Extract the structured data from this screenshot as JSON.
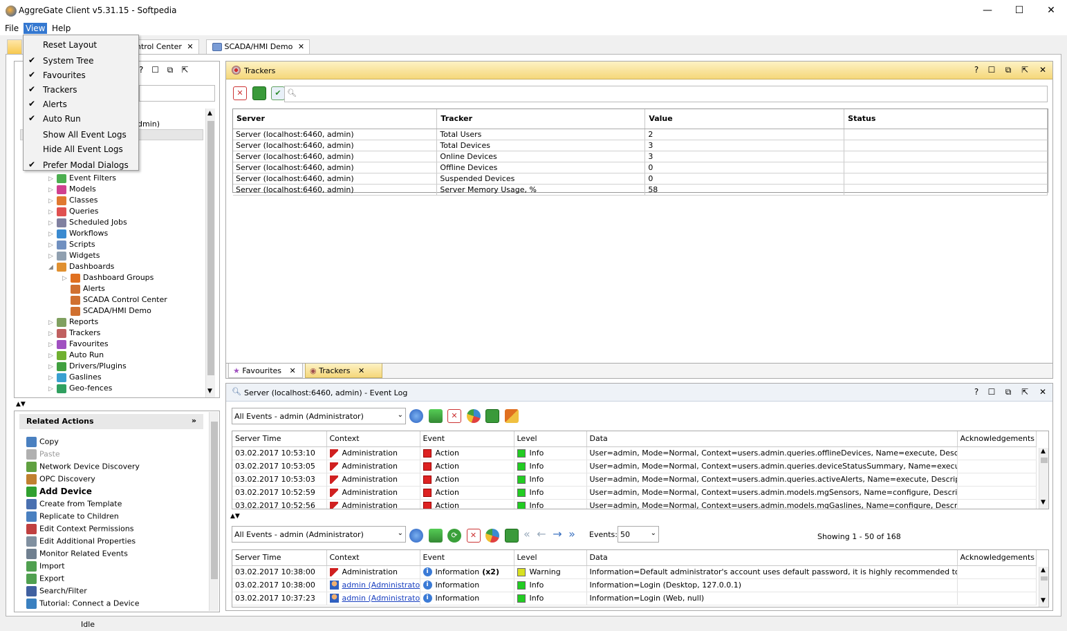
{
  "window": {
    "title": "AggreGate Client v5.31.15 - Softpedia",
    "minimize": "—",
    "maximize": "☐",
    "close": "✕"
  },
  "menubar": {
    "file": "File",
    "view": "View",
    "help": "Help"
  },
  "view_menu": {
    "items": [
      {
        "label": "Reset Layout",
        "checked": false
      },
      {
        "label": "System Tree",
        "checked": true
      },
      {
        "label": "Favourites",
        "checked": true
      },
      {
        "label": "Trackers",
        "checked": true
      },
      {
        "label": "Alerts",
        "checked": true
      },
      {
        "label": "Auto Run",
        "checked": true
      },
      {
        "label": "Show All Event Logs",
        "checked": false
      },
      {
        "label": "Hide All Event Logs",
        "checked": false
      },
      {
        "label": "Prefer Modal Dialogs",
        "checked": true
      }
    ],
    "check": "✔"
  },
  "doc_tabs": {
    "tab1": "ntrol Center",
    "tab2": "SCADA/HMI Demo",
    "close": "✕"
  },
  "system_tree": {
    "partial": "dmin)",
    "items": [
      {
        "label": "Event Filters",
        "arrow": "▷",
        "color": "#4caf50",
        "indent": 0
      },
      {
        "label": "Models",
        "arrow": "▷",
        "color": "#d04090",
        "indent": 0
      },
      {
        "label": "Classes",
        "arrow": "▷",
        "color": "#e07830",
        "indent": 0
      },
      {
        "label": "Queries",
        "arrow": "▷",
        "color": "#e05050",
        "indent": 0
      },
      {
        "label": "Scheduled Jobs",
        "arrow": "▷",
        "color": "#8080a0",
        "indent": 0
      },
      {
        "label": "Workflows",
        "arrow": "▷",
        "color": "#3a8ad0",
        "indent": 0
      },
      {
        "label": "Scripts",
        "arrow": "▷",
        "color": "#7090c0",
        "indent": 0
      },
      {
        "label": "Widgets",
        "arrow": "▷",
        "color": "#90a0b0",
        "indent": 0
      },
      {
        "label": "Dashboards",
        "arrow": "◢",
        "color": "#e09030",
        "indent": 0
      },
      {
        "label": "Dashboard Groups",
        "arrow": "▷",
        "color": "#e07020",
        "indent": 1
      },
      {
        "label": "Alerts",
        "arrow": "",
        "color": "#d07030",
        "indent": 1
      },
      {
        "label": "SCADA Control Center",
        "arrow": "",
        "color": "#d07030",
        "indent": 1
      },
      {
        "label": "SCADA/HMI Demo",
        "arrow": "",
        "color": "#d07030",
        "indent": 1
      },
      {
        "label": "Reports",
        "arrow": "▷",
        "color": "#80a060",
        "indent": 0
      },
      {
        "label": "Trackers",
        "arrow": "▷",
        "color": "#c06060",
        "indent": 0
      },
      {
        "label": "Favourites",
        "arrow": "▷",
        "color": "#a050c0",
        "indent": 0
      },
      {
        "label": "Auto Run",
        "arrow": "▷",
        "color": "#70b030",
        "indent": 0
      },
      {
        "label": "Drivers/Plugins",
        "arrow": "▷",
        "color": "#40a040",
        "indent": 0
      },
      {
        "label": "Gaslines",
        "arrow": "▷",
        "color": "#3aa0d0",
        "indent": 0
      },
      {
        "label": "Geo-fences",
        "arrow": "▷",
        "color": "#30a060",
        "indent": 0
      }
    ]
  },
  "related_actions": {
    "title": "Related Actions",
    "collapse": "»",
    "items": [
      {
        "label": "Copy",
        "bold": false,
        "disabled": false,
        "color": "#4a80c0"
      },
      {
        "label": "Paste",
        "bold": false,
        "disabled": true,
        "color": "#b0b0b0"
      },
      {
        "label": "Network Device Discovery",
        "bold": false,
        "disabled": false,
        "color": "#60a040"
      },
      {
        "label": "OPC Discovery",
        "bold": false,
        "disabled": false,
        "color": "#c08030"
      },
      {
        "label": "Add Device",
        "bold": true,
        "disabled": false,
        "color": "#30a030"
      },
      {
        "label": "Create from Template",
        "bold": false,
        "disabled": false,
        "color": "#4a70b0"
      },
      {
        "label": "Replicate to Children",
        "bold": false,
        "disabled": false,
        "color": "#4a80c0"
      },
      {
        "label": "Edit Context Permissions",
        "bold": false,
        "disabled": false,
        "color": "#c04040"
      },
      {
        "label": "Edit Additional Properties",
        "bold": false,
        "disabled": false,
        "color": "#8090a0"
      },
      {
        "label": "Monitor Related Events",
        "bold": false,
        "disabled": false,
        "color": "#708090"
      },
      {
        "label": "Import",
        "bold": false,
        "disabled": false,
        "color": "#50a050"
      },
      {
        "label": "Export",
        "bold": false,
        "disabled": false,
        "color": "#50a050"
      },
      {
        "label": "Search/Filter",
        "bold": false,
        "disabled": false,
        "color": "#4060a0"
      },
      {
        "label": "Tutorial: Connect a Device",
        "bold": false,
        "disabled": false,
        "color": "#3a80c0"
      }
    ]
  },
  "trackers": {
    "title": "Trackers",
    "search_glyph": "🔍︎",
    "columns": [
      "Server",
      "Tracker",
      "Value",
      "Status"
    ],
    "rows": [
      [
        "Server (localhost:6460, admin)",
        "Total Users",
        "2",
        ""
      ],
      [
        "Server (localhost:6460, admin)",
        "Total Devices",
        "3",
        ""
      ],
      [
        "Server (localhost:6460, admin)",
        "Online Devices",
        "3",
        ""
      ],
      [
        "Server (localhost:6460, admin)",
        "Offline Devices",
        "0",
        ""
      ],
      [
        "Server (localhost:6460, admin)",
        "Suspended Devices",
        "0",
        ""
      ],
      [
        "Server (localhost:6460, admin)",
        "Server Memory Usage, %",
        "58",
        ""
      ]
    ],
    "bottom_tabs": [
      "Favourites",
      "Trackers"
    ]
  },
  "panel_buttons": {
    "help": "?",
    "max": "☐",
    "restore": "⧉",
    "pin": "⇱",
    "close": "✕"
  },
  "event_log": {
    "title": "Server (localhost:6460, admin) - Event Log",
    "filter": "All Events - admin (Administrator)",
    "columns": [
      "Server Time",
      "Context",
      "Event",
      "Level",
      "Data",
      "Acknowledgements"
    ],
    "rows": [
      {
        "time": "03.02.2017 10:53:10",
        "context": "Administration",
        "event": "Action",
        "level": "Info",
        "data": "User=admin, Mode=Normal, Context=users.admin.queries.offlineDevices, Name=execute, Description=E..."
      },
      {
        "time": "03.02.2017 10:53:05",
        "context": "Administration",
        "event": "Action",
        "level": "Info",
        "data": "User=admin, Mode=Normal, Context=users.admin.queries.deviceStatusSummary, Name=execute, Descrip..."
      },
      {
        "time": "03.02.2017 10:53:03",
        "context": "Administration",
        "event": "Action",
        "level": "Info",
        "data": "User=admin, Mode=Normal, Context=users.admin.queries.activeAlerts, Name=execute, Description=Exe..."
      },
      {
        "time": "03.02.2017 10:52:59",
        "context": "Administration",
        "event": "Action",
        "level": "Info",
        "data": "User=admin, Mode=Normal, Context=users.admin.models.mgSensors, Name=configure, Description=Con..."
      },
      {
        "time": "03.02.2017 10:52:56",
        "context": "Administration",
        "event": "Action",
        "level": "Info",
        "data": "User=admin, Mode=Normal, Context=users.admin.models.mgGaslines, Name=configure, Description=Con..."
      }
    ],
    "filter2": "All Events - admin (Administrator)",
    "events_label": "Events:",
    "events_value": "50",
    "showing": "Showing 1 - 50 of 168",
    "rows2": [
      {
        "time": "03.02.2017 10:38:00",
        "context": "Administration",
        "ctx_link": false,
        "event": "Information",
        "event_bold": "(x2)",
        "level": "Warning",
        "data": "Information=Default administrator's account uses default password, it is highly recommended to change it"
      },
      {
        "time": "03.02.2017 10:38:00",
        "context": "admin (Administrator)",
        "ctx_link": true,
        "event": "Information",
        "event_bold": "",
        "level": "Info",
        "data": "Information=Login (Desktop, 127.0.0.1)"
      },
      {
        "time": "03.02.2017 10:37:23",
        "context": "admin (Administrator)",
        "ctx_link": true,
        "event": "Information",
        "event_bold": "",
        "level": "Info",
        "data": "Information=Login (Web, null)"
      }
    ]
  },
  "colors": {
    "info": "#22cc22",
    "warning": "#d8e020",
    "accent": "#3478d0"
  },
  "status": {
    "text": "Idle"
  }
}
